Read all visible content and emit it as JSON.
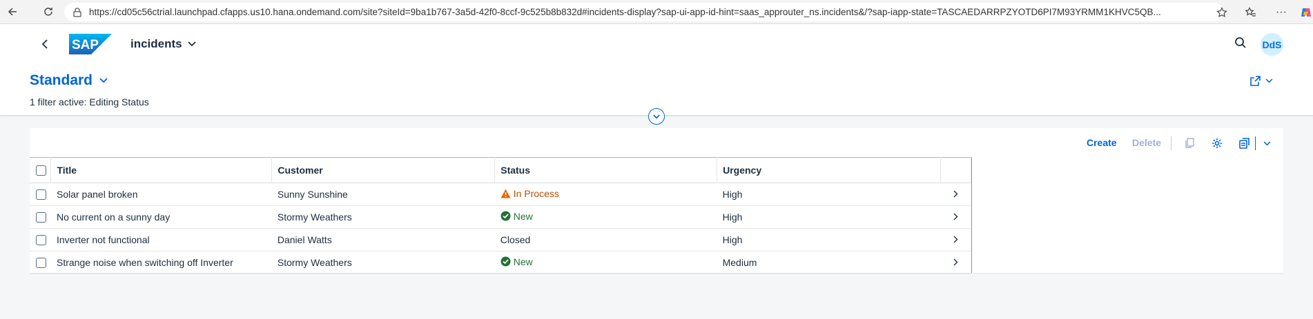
{
  "browser": {
    "url": "https://cd05c56ctrial.launchpad.cfapps.us10.hana.ondemand.com/site?siteId=9ba1b767-3a5d-42f0-8ccf-9c525b8b832d#incidents-display?sap-ui-app-id-hint=saas_approuter_ns.incidents&/?sap-iapp-state=TASCAEDARRPZYOTD6PI7M93YRMM1KHVC5QB..."
  },
  "shell": {
    "logo_text": "SAP",
    "app_title": "incidents",
    "avatar_initials": "DdS"
  },
  "header": {
    "variant_name": "Standard",
    "filter_info": "1 filter active: Editing Status"
  },
  "toolbar": {
    "create_label": "Create",
    "delete_label": "Delete"
  },
  "table": {
    "columns": [
      "Title",
      "Customer",
      "Status",
      "Urgency"
    ],
    "rows": [
      {
        "title": "Solar panel broken",
        "customer": "Sunny Sunshine",
        "status": "In Process",
        "status_type": "warning",
        "urgency": "High"
      },
      {
        "title": "No current on a sunny day",
        "customer": "Stormy Weathers",
        "status": "New",
        "status_type": "success",
        "urgency": "High"
      },
      {
        "title": "Inverter not functional",
        "customer": "Daniel Watts",
        "status": "Closed",
        "status_type": "none",
        "urgency": "High"
      },
      {
        "title": "Strange noise when switching off Inverter",
        "customer": "Stormy Weathers",
        "status": "New",
        "status_type": "success",
        "urgency": "Medium"
      }
    ]
  },
  "colors": {
    "accent": "#0064d9",
    "warning": "#e76500",
    "success": "#256f3a",
    "sap_logo": "#0a6ed1"
  }
}
